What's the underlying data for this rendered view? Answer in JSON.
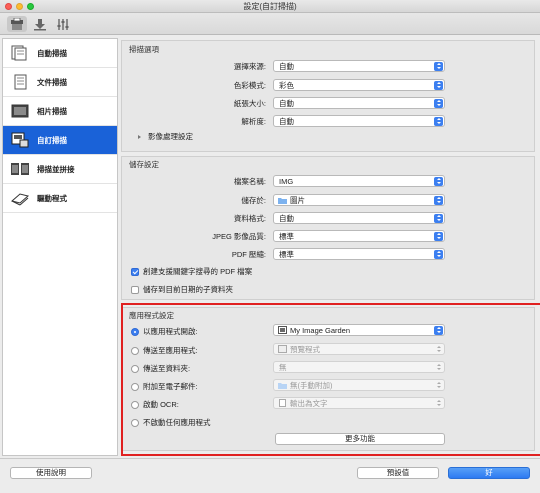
{
  "window": {
    "title": "設定(自訂掃描)"
  },
  "toolbar": {
    "icons": [
      "scan-settings-icon",
      "download-icon",
      "general-settings-icon"
    ]
  },
  "sidebar": {
    "items": [
      {
        "label": "自動掃描",
        "icon": "auto-scan-icon"
      },
      {
        "label": "文件掃描",
        "icon": "document-scan-icon"
      },
      {
        "label": "相片掃描",
        "icon": "photo-scan-icon"
      },
      {
        "label": "自訂掃描",
        "icon": "custom-scan-icon",
        "active": true
      },
      {
        "label": "掃描並拼接",
        "icon": "scan-and-stitch-icon"
      },
      {
        "label": "驅動程式",
        "icon": "driver-icon"
      }
    ]
  },
  "scan_options": {
    "title": "掃描選項",
    "source_label": "選擇來源:",
    "source_value": "自動",
    "color_label": "色彩模式:",
    "color_value": "彩色",
    "paper_label": "紙張大小:",
    "paper_value": "自動",
    "resolution_label": "解析度:",
    "resolution_value": "自動",
    "image_processing": "影像處理設定"
  },
  "save_settings": {
    "title": "儲存設定",
    "filename_label": "檔案名稱:",
    "filename_value": "IMG",
    "save_in_label": "儲存於:",
    "save_in_value": "圖片",
    "format_label": "資料格式:",
    "format_value": "自動",
    "jpeg_label": "JPEG 影像品質:",
    "jpeg_value": "標準",
    "pdf_label": "PDF 壓縮:",
    "pdf_value": "標準",
    "check1": "創建支援關鍵字搜尋的 PDF 檔案",
    "check1_on": true,
    "check2": "儲存到目前日期的子資料夾",
    "check2_on": false
  },
  "app_settings": {
    "title": "應用程式設定",
    "opt1_label": "以應用程式開啟:",
    "opt1_value": "My Image Garden",
    "opt2_label": "傳送至應用程式:",
    "opt2_value": "預覽程式",
    "opt3_label": "傳送至資料夾:",
    "opt3_value": "無",
    "opt4_label": "附加至電子郵件:",
    "opt4_value": "無(手動附加)",
    "opt5_label": "啟動 OCR:",
    "opt5_value": "輸出為文字",
    "opt6_label": "不啟動任何應用程式",
    "more": "更多功能"
  },
  "footer": {
    "help": "使用說明",
    "defaults": "預設值",
    "ok": "好"
  },
  "colors": {
    "accent": "#1a62d8",
    "highlight": "#e02020"
  }
}
